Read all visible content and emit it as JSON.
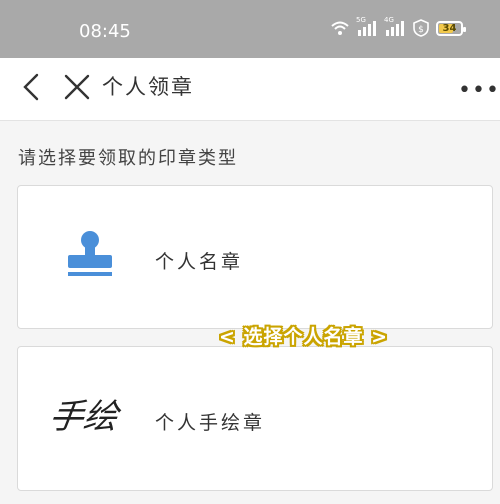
{
  "status_bar": {
    "time": "08:45",
    "signal_label_1": "5G",
    "signal_label_2": "4G",
    "battery": "34"
  },
  "nav": {
    "title": "个人领章",
    "more": "•••"
  },
  "prompt": "请选择要领取的印章类型",
  "options": [
    {
      "label": "个人名章",
      "icon": "stamp-icon"
    },
    {
      "label": "个人手绘章",
      "icon": "signature-icon",
      "icon_text": "手绘"
    }
  ],
  "overlay_annotation": "< 选择个人名章 >",
  "colors": {
    "status_bar_bg": "#a9a9a9",
    "stamp_blue": "#4a8fd9",
    "annotation_yellow": "#caa400"
  }
}
